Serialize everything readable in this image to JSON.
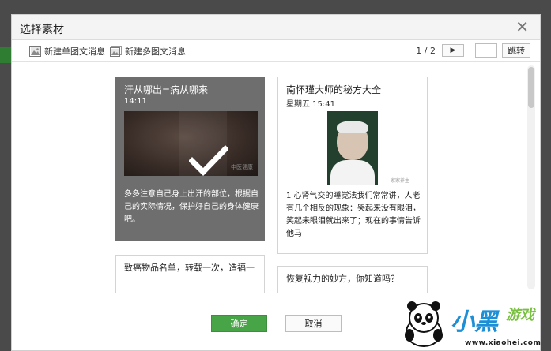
{
  "dialog": {
    "title": "选择素材",
    "close_symbol": "✕"
  },
  "toolbar": {
    "new_single": "新建单图文消息",
    "new_multi": "新建多图文消息",
    "page_indicator": "1 / 2",
    "next_symbol": "▶",
    "page_input_value": "",
    "jump_label": "跳转"
  },
  "cards": [
    {
      "title": "汗从哪出=病从哪来",
      "date": "14:11",
      "desc": "多多注意自己身上出汗的部位，根据自己的实际情况，保护好自己的身体健康吧。",
      "selected": true,
      "thumb_logo": "中医健康"
    },
    {
      "title": "南怀瑾大师的秘方大全",
      "date": "星期五 15:41",
      "desc": "1 心肾气交的睡觉法我们常常讲，人老有几个相反的现象：哭起来没有眼泪，笑起来眼泪就出来了；现在的事情告诉他马",
      "selected": false,
      "thumb_logo": "家家养生"
    },
    {
      "title": "致癌物品名单，转载一次，造福一",
      "selected": false
    },
    {
      "title": "恢复视力的妙方，你知道吗？",
      "selected": false
    }
  ],
  "footer": {
    "confirm": "确定",
    "cancel": "取消"
  },
  "brand": {
    "name_part1": "小黑",
    "name_part2": "游戏",
    "url": "www.xiaohei.com"
  },
  "colors": {
    "confirm_green": "#47a447",
    "selected_overlay": "#6e6e6e",
    "brand_blue": "#1c8fd6",
    "brand_green": "#7ac043"
  }
}
